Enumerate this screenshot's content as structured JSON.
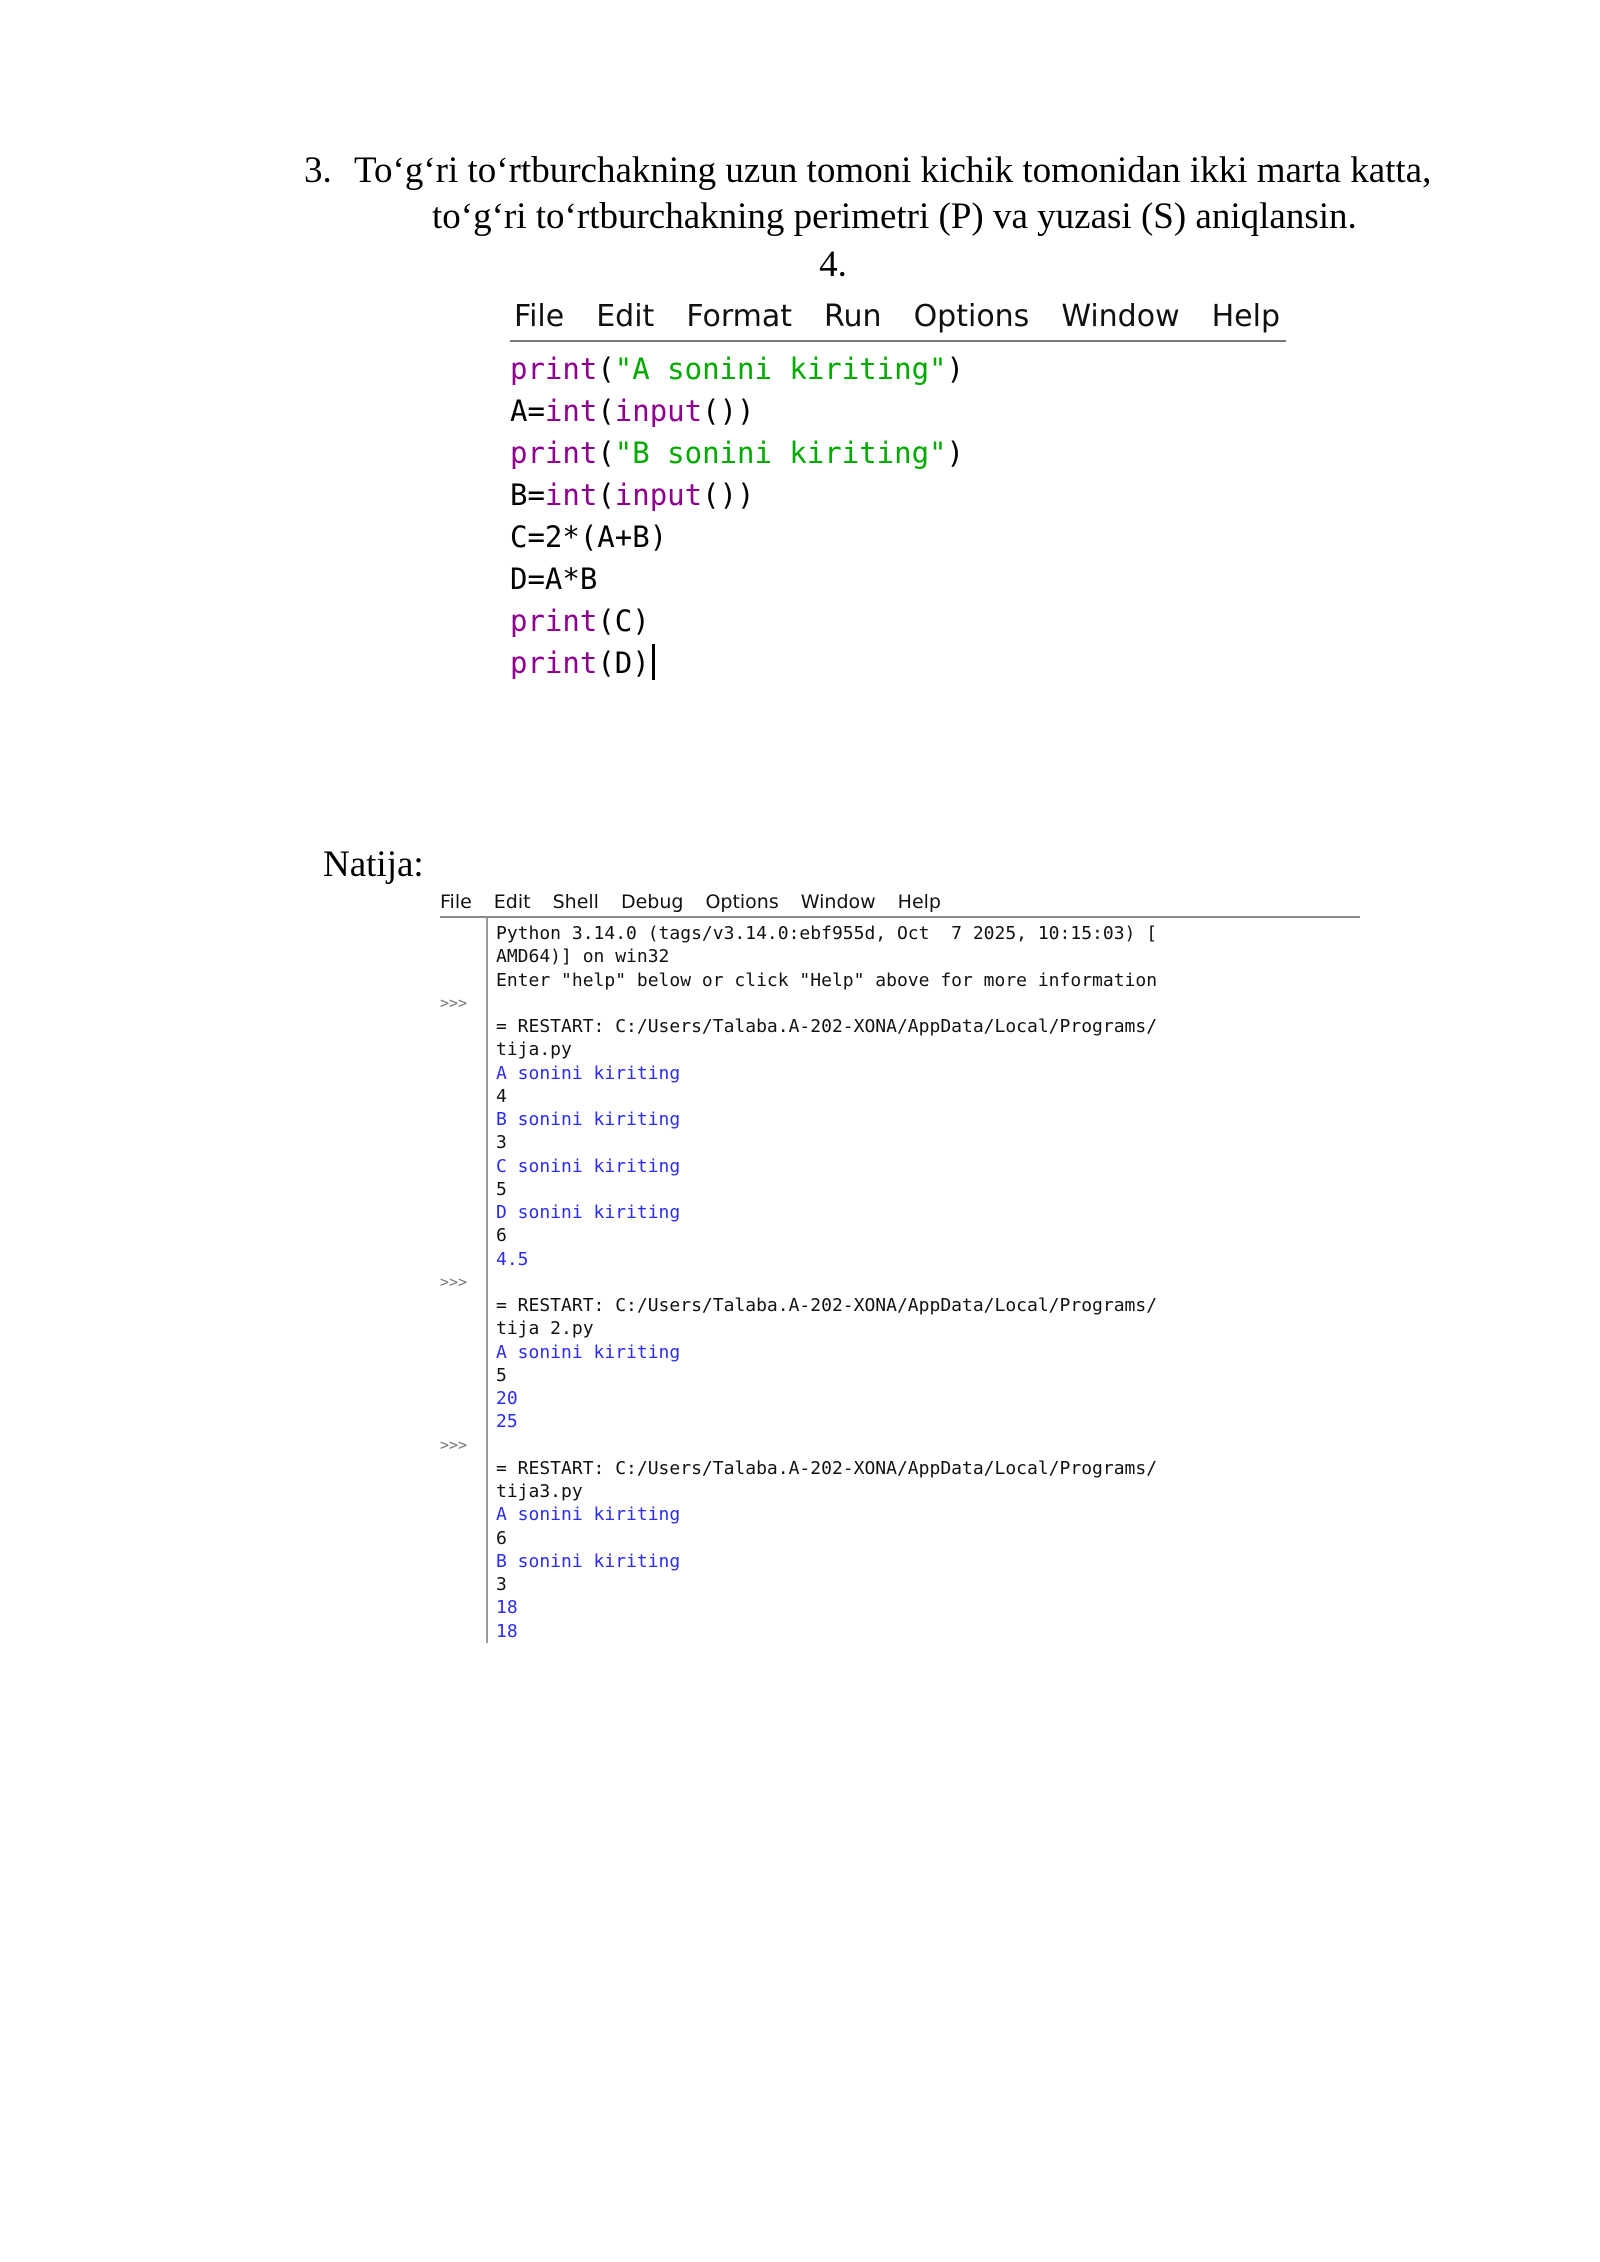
{
  "problem": {
    "number": "3.",
    "line1": "To‘g‘ri to‘rtburchakning uzun tomoni kichik tomonidan ikki marta katta,",
    "line2": "to‘g‘ri to‘rtburchakning perimetri (P) va yuzasi (S) aniqlansin."
  },
  "item4": "4.",
  "editor": {
    "menu": [
      "File",
      "Edit",
      "Format",
      "Run",
      "Options",
      "Window",
      "Help"
    ],
    "code": [
      [
        {
          "t": "print",
          "c": "kw"
        },
        {
          "t": "(",
          "c": "pl"
        },
        {
          "t": "\"A sonini kiriting\"",
          "c": "str"
        },
        {
          "t": ")",
          "c": "pl"
        }
      ],
      [
        {
          "t": "A=",
          "c": "pl"
        },
        {
          "t": "int",
          "c": "kw"
        },
        {
          "t": "(",
          "c": "pl"
        },
        {
          "t": "input",
          "c": "kw"
        },
        {
          "t": "())",
          "c": "pl"
        }
      ],
      [
        {
          "t": "print",
          "c": "kw"
        },
        {
          "t": "(",
          "c": "pl"
        },
        {
          "t": "\"B sonini kiriting\"",
          "c": "str"
        },
        {
          "t": ")",
          "c": "pl"
        }
      ],
      [
        {
          "t": "B=",
          "c": "pl"
        },
        {
          "t": "int",
          "c": "kw"
        },
        {
          "t": "(",
          "c": "pl"
        },
        {
          "t": "input",
          "c": "kw"
        },
        {
          "t": "())",
          "c": "pl"
        }
      ],
      [
        {
          "t": "C=2*(A+B)",
          "c": "pl"
        }
      ],
      [
        {
          "t": "D=A*B",
          "c": "pl"
        }
      ],
      [
        {
          "t": "print",
          "c": "kw"
        },
        {
          "t": "(C)",
          "c": "pl"
        }
      ],
      [
        {
          "t": "print",
          "c": "kw"
        },
        {
          "t": "(D)",
          "c": "pl"
        }
      ]
    ]
  },
  "natija_label": "Natija:",
  "shell": {
    "menu": [
      "File",
      "Edit",
      "Shell",
      "Debug",
      "Options",
      "Window",
      "Help"
    ],
    "prompt": ">>>",
    "lines": [
      {
        "text": "Python 3.14.0 (tags/v3.14.0:ebf955d, Oct  7 2025, 10:15:03) [",
        "type": "sys"
      },
      {
        "text": "AMD64)] on win32",
        "type": "sys"
      },
      {
        "text": "Enter \"help\" below or click \"Help\" above for more information",
        "type": "sys"
      },
      {
        "text": "",
        "type": "prompt"
      },
      {
        "text": "= RESTART: C:/Users/Talaba.A-202-XONA/AppData/Local/Programs/",
        "type": "sys"
      },
      {
        "text": "tija.py",
        "type": "sys"
      },
      {
        "text": "A sonini kiriting",
        "type": "out"
      },
      {
        "text": "4",
        "type": "sys"
      },
      {
        "text": "B sonini kiriting",
        "type": "out"
      },
      {
        "text": "3",
        "type": "sys"
      },
      {
        "text": "C sonini kiriting",
        "type": "out"
      },
      {
        "text": "5",
        "type": "sys"
      },
      {
        "text": "D sonini kiriting",
        "type": "out"
      },
      {
        "text": "6",
        "type": "sys"
      },
      {
        "text": "4.5",
        "type": "out"
      },
      {
        "text": "",
        "type": "prompt"
      },
      {
        "text": "= RESTART: C:/Users/Talaba.A-202-XONA/AppData/Local/Programs/",
        "type": "sys"
      },
      {
        "text": "tija 2.py",
        "type": "sys"
      },
      {
        "text": "A sonini kiriting",
        "type": "out"
      },
      {
        "text": "5",
        "type": "sys"
      },
      {
        "text": "20",
        "type": "out"
      },
      {
        "text": "25",
        "type": "out"
      },
      {
        "text": "",
        "type": "prompt"
      },
      {
        "text": "= RESTART: C:/Users/Talaba.A-202-XONA/AppData/Local/Programs/",
        "type": "sys"
      },
      {
        "text": "tija3.py",
        "type": "sys"
      },
      {
        "text": "A sonini kiriting",
        "type": "out"
      },
      {
        "text": "6",
        "type": "sys"
      },
      {
        "text": "B sonini kiriting",
        "type": "out"
      },
      {
        "text": "3",
        "type": "sys"
      },
      {
        "text": "18",
        "type": "out"
      },
      {
        "text": "18",
        "type": "out"
      }
    ]
  },
  "colors": {
    "keyword": "#900090",
    "string": "#00aa00",
    "shell_output": "#2c2cf0"
  }
}
